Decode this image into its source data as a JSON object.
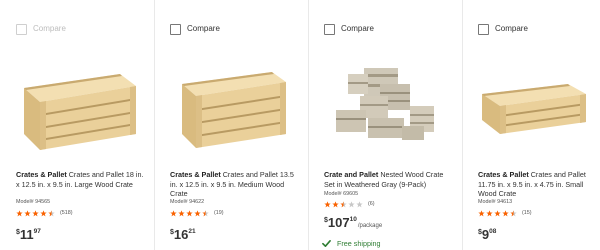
{
  "compare_label": "Compare",
  "colors": {
    "star_fill": "#f96302",
    "star_empty": "#c8c8c8",
    "ship_green": "#2e7d32",
    "wood": "#e9cf98"
  },
  "products": [
    {
      "compare_state": "disabled",
      "brand": "Crates & Pallet",
      "name": "Crates and Pallet 18 in. x 12.5 in. x 9.5 in. Large Wood Crate",
      "model": "Model# 94565",
      "rating": 4.5,
      "reviews": "(518)",
      "price": {
        "currency": "$",
        "dollars": "11",
        "cents": "97",
        "per": ""
      },
      "image": "large-wood-crate"
    },
    {
      "compare_state": "enabled",
      "brand": "Crates & Pallet",
      "name": "Crates and Pallet 13.5 in. x 12.5 in. x 9.5 in. Medium Wood Crate",
      "model": "Model# 94622",
      "rating": 4.5,
      "reviews": "(19)",
      "price": {
        "currency": "$",
        "dollars": "16",
        "cents": "21",
        "per": ""
      },
      "image": "medium-wood-crate"
    },
    {
      "compare_state": "enabled",
      "brand": "Crate and Pallet",
      "name": "Nested Wood Crate Set in Weathered Gray (9-Pack)",
      "model": "Model# 69605",
      "rating": 2.5,
      "reviews": "(6)",
      "price": {
        "currency": "$",
        "dollars": "107",
        "cents": "10",
        "per": "/package"
      },
      "shipping": "Free shipping",
      "image": "nested-gray-crate-set"
    },
    {
      "compare_state": "enabled",
      "brand": "Crates & Pallet",
      "name": "Crates and Pallet 11.75 in. x 9.5 in. x 4.75 in. Small Wood Crate",
      "model": "Model# 94613",
      "rating": 4.5,
      "reviews": "(15)",
      "price": {
        "currency": "$",
        "dollars": "9",
        "cents": "08",
        "per": ""
      },
      "image": "small-wood-crate"
    }
  ]
}
